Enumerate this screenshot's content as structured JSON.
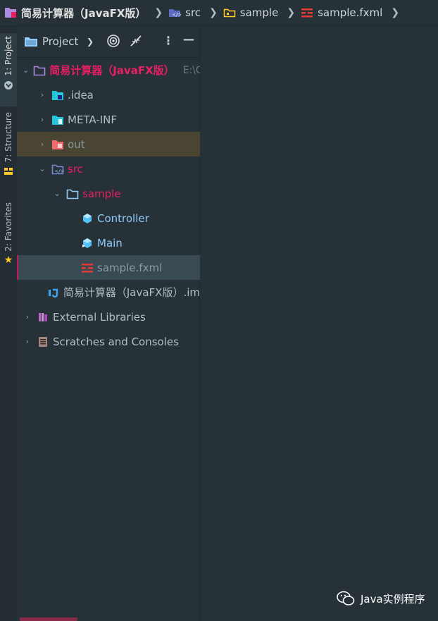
{
  "breadcrumb": {
    "project": "简易计算器（JavaFX版）",
    "src": "src",
    "sample": "sample",
    "file": "sample.fxml"
  },
  "toolstrip": {
    "project_tab": "1: Project",
    "structure_tab": "7: Structure",
    "favorites_tab": "2: Favorites"
  },
  "panel": {
    "title": "Project"
  },
  "tree": {
    "root": {
      "label": "简易计算器（JavaFX版）",
      "path": "E:\\Gi"
    },
    "idea": ".idea",
    "meta": "META-INF",
    "out": "out",
    "src": "src",
    "sample": "sample",
    "controller": "Controller",
    "main": "Main",
    "fxml": "sample.fxml",
    "iml": "简易计算器（JavaFX版）.im",
    "external": "External Libraries",
    "scratches": "Scratches and Consoles"
  },
  "watermark": "Java实例程序",
  "colors": {
    "background": "#263238",
    "accent_pink": "#e91e63",
    "out_highlight": "#4a4432",
    "selection": "#3a4a52"
  }
}
